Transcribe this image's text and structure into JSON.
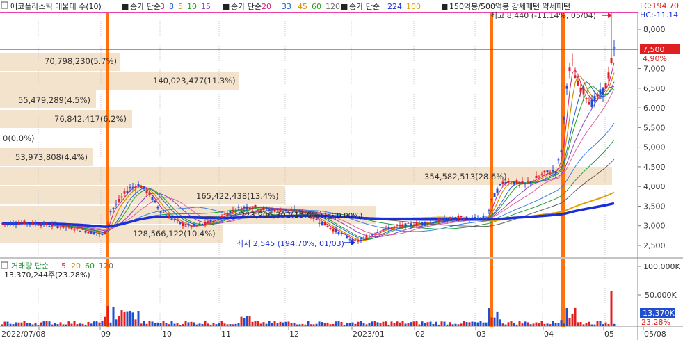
{
  "legend": {
    "title": "에코플라스틱 매물대 수(10)",
    "ma1_label": "종가 단순",
    "ma1_periods": [
      "3",
      "8",
      "5",
      "10",
      "15"
    ],
    "ma2_label": "종가 단순",
    "ma2_periods": [
      "20",
      "33",
      "45",
      "60",
      "120"
    ],
    "ma3_label": "종가 단순",
    "ma3_periods": [
      "224",
      "100"
    ],
    "pattern": "150억봉/500억봉 강세패턴 약세패턴"
  },
  "price_axis": {
    "ticks": [
      "8,000",
      "7,500",
      "7,000",
      "6,500",
      "6,000",
      "5,500",
      "5,000",
      "4,500",
      "4,000",
      "3,500",
      "3,000",
      "2,500"
    ],
    "lc": "LC:194.70",
    "hc": "HC:-11.14",
    "current": "7,500",
    "change": "4.90%"
  },
  "volume_axis": {
    "ticks": [
      "100,000K",
      "50,000K"
    ],
    "current": "13,370K",
    "ratio": "23.28%"
  },
  "volume_legend": {
    "label": "거래량 단순",
    "periods": [
      "5",
      "20",
      "60",
      "120"
    ],
    "value": "13,370,244주(23.28%)"
  },
  "date_axis": [
    "2022/07/08",
    "09",
    "10",
    "11",
    "12",
    "2023/01",
    "02",
    "03",
    "04",
    "05",
    "05/08"
  ],
  "annotations": {
    "high": "최고 8,440 (-11.14%, 05/04)",
    "low": "최저 2,545 (194.70%, 01/03)"
  },
  "volume_profile": [
    {
      "label": "70,798,230(5.7%)",
      "price": 7100
    },
    {
      "label": "140,023,477(11.3%)",
      "price": 6600
    },
    {
      "label": "55,479,289(4.5%)",
      "price": 6100
    },
    {
      "label": "76,842,417(6.2%)",
      "price": 5650
    },
    {
      "label": "0(0.0%)",
      "price": 5100
    },
    {
      "label": "53,973,808(4.4%)",
      "price": 4650
    },
    {
      "label": "354,582,513(28.6%)",
      "price": 4150
    },
    {
      "label": "165,422,438(13.4%)",
      "price": 3650
    },
    {
      "label": "223,906,302(15.6%)",
      "price": 3200
    },
    {
      "label": "128,566,122(10.4%)",
      "price": 2750
    }
  ],
  "profile_tag": "|다량(0.00%)",
  "colors": {
    "candle_up": "#e02020",
    "candle_down": "#1f4fd0",
    "ma224": "#1a2fd8",
    "ma120": "#e0a000",
    "signal_bar": "#ff6a00",
    "profile_band": "#f3e2cc",
    "high_line": "#e8008a",
    "current_line": "#e0203a"
  }
}
